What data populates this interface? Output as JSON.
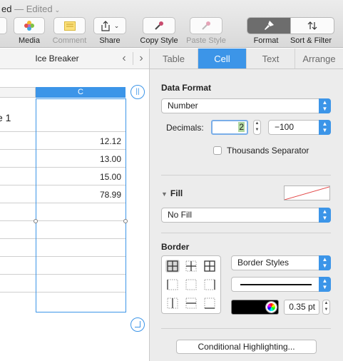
{
  "window": {
    "title": "ed",
    "title_status": " — Edited"
  },
  "toolbar": {
    "media_label": "Media",
    "comment_label": "Comment",
    "share_label": "Share",
    "copy_style_label": "Copy Style",
    "paste_style_label": "Paste Style",
    "format_label": "Format",
    "sort_filter_label": "Sort & Filter"
  },
  "sheet": {
    "name": "Ice Breaker",
    "column_label": "C",
    "table_title": "e 1",
    "values": [
      "12.12",
      "13.00",
      "15.00",
      "78.99"
    ]
  },
  "inspector": {
    "tabs": [
      {
        "label": "Table",
        "active": false
      },
      {
        "label": "Cell",
        "active": true
      },
      {
        "label": "Text",
        "active": false
      },
      {
        "label": "Arrange",
        "active": false
      }
    ],
    "data_format": {
      "title": "Data Format",
      "format": "Number",
      "decimals_label": "Decimals:",
      "decimals_value": "2",
      "negative_style": "−100",
      "thousands_label": "Thousands Separator",
      "thousands_checked": false
    },
    "fill": {
      "title": "Fill",
      "value": "No Fill"
    },
    "border": {
      "title": "Border",
      "styles_label": "Border Styles",
      "color": "#000000",
      "width": "0.35 pt"
    },
    "conditional_label": "Conditional Highlighting..."
  },
  "colors": {
    "accent": "#3c95e8",
    "toolbar_active": "#6d6d6d"
  }
}
